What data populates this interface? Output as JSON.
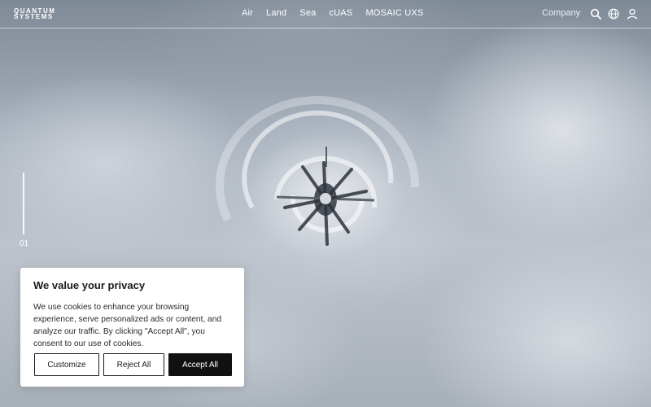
{
  "header": {
    "logo_line1": "QUANTUM",
    "logo_line2": "SYSTEMS",
    "nav": [
      {
        "label": "Air"
      },
      {
        "label": "Land"
      },
      {
        "label": "Sea"
      },
      {
        "label": "cUAS"
      },
      {
        "label": "MOSAIC UXS"
      }
    ],
    "company_label": "Company",
    "icons": [
      "search-icon",
      "globe-icon",
      "user-icon"
    ]
  },
  "hero": {
    "slide_number": "01"
  },
  "cookie_banner": {
    "title": "We value your privacy",
    "text": "We use cookies to enhance your browsing experience, serve personalized ads or content, and analyze our traffic. By clicking \"Accept All\", you consent to our use of cookies.",
    "customize_label": "Customize",
    "reject_label": "Reject All",
    "accept_label": "Accept All"
  },
  "colors": {
    "accept_bg": "#111111",
    "banner_bg": "#ffffff",
    "header_text": "#ffffff"
  }
}
